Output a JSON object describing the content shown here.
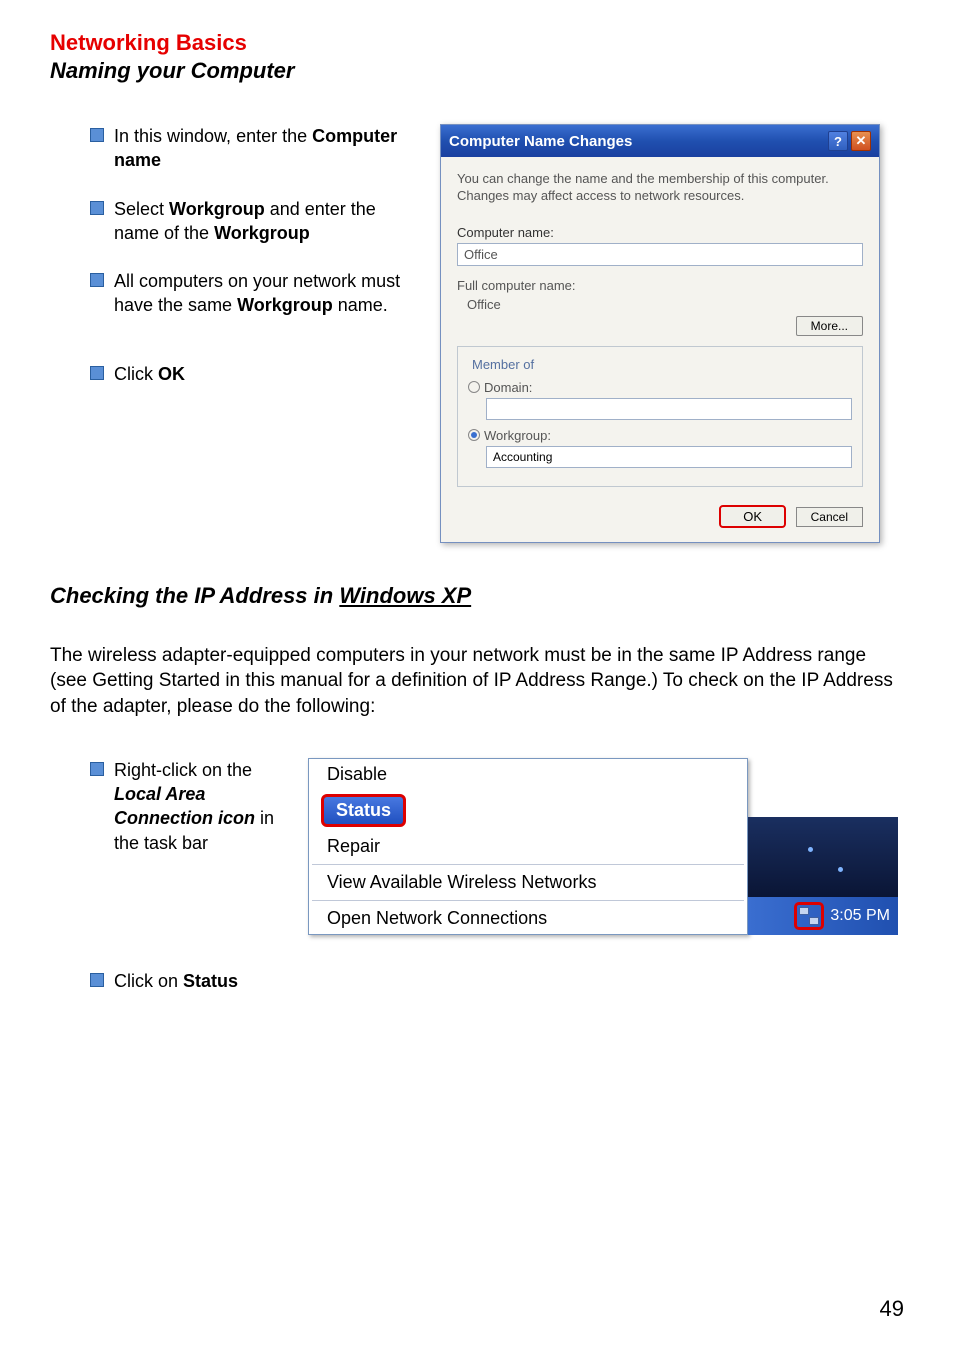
{
  "page_number": "49",
  "heading_red": "Networking Basics",
  "heading_black": "Naming your Computer",
  "bullets1": [
    {
      "prefix": "In this window, enter the ",
      "bold": "Computer name",
      "suffix": ""
    },
    {
      "prefix": "Select ",
      "bold": "Workgroup",
      "mid": " and enter the name of the ",
      "bold2": "Workgroup"
    },
    {
      "prefix": "All computers on your network must have the same ",
      "bold": "Workgroup",
      "suffix": " name."
    },
    {
      "prefix": "Click ",
      "bold": "OK",
      "suffix": ""
    }
  ],
  "xp_dialog": {
    "title": "Computer Name Changes",
    "help_btn": "?",
    "close_btn": "✕",
    "description": "You can change the name and the membership of this computer. Changes may affect access to network resources.",
    "computer_name_label": "Computer name:",
    "computer_name_value": "Office",
    "full_computer_name_label": "Full computer name:",
    "full_computer_name_value": "Office",
    "more_btn": "More...",
    "member_of_label": "Member of",
    "domain_label": "Domain:",
    "domain_value": "",
    "workgroup_label": "Workgroup:",
    "workgroup_value": "Accounting",
    "ok_btn": "OK",
    "cancel_btn": "Cancel"
  },
  "section2_heading_prefix": "Checking the IP Address in ",
  "section2_heading_underline": "Windows XP",
  "section2_text": "The wireless adapter-equipped computers in your network must be in the same IP Address range (see Getting Started in this manual for a definition of IP Address Range.)  To check on the IP Address of the adapter, please do the following:",
  "bullets2": [
    {
      "prefix": "Right-click on the ",
      "bold_italic": "Local Area Connection icon",
      "suffix": " in the task bar"
    },
    {
      "prefix": "Click on ",
      "bold": "Status",
      "suffix": ""
    }
  ],
  "context_menu": {
    "disable": "Disable",
    "status": "Status",
    "repair": "Repair",
    "view_networks": "View Available Wireless Networks",
    "open_connections": "Open Network Connections"
  },
  "taskbar": {
    "time": "3:05 PM"
  }
}
